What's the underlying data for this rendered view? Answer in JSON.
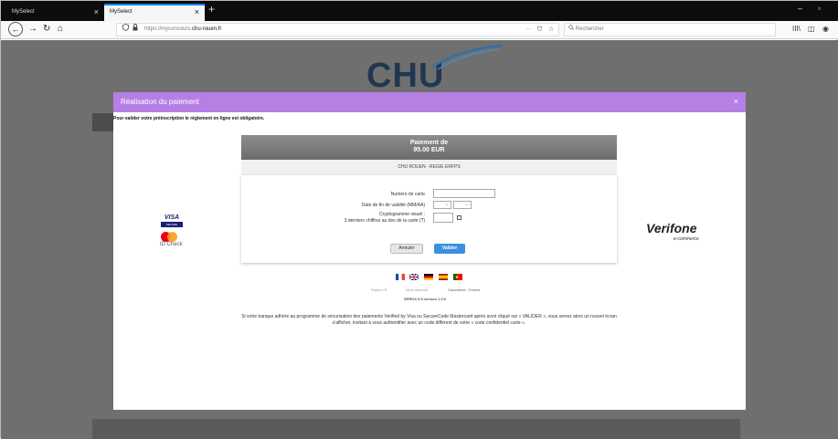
{
  "browser": {
    "tabs": [
      {
        "label": "MySelect"
      },
      {
        "label": "MySelect"
      }
    ],
    "new_tab": "+",
    "tab_close": "×",
    "window_controls": {
      "minimize": "–",
      "maximize": "▫"
    },
    "nav": {
      "back": "←",
      "forward": "→",
      "reload": "↻",
      "home": "⌂"
    },
    "url": {
      "prefix": "https://myconcours.",
      "domain": "chu-rouen.fr"
    },
    "url_actions": {
      "more": "···",
      "pocket": "⛉",
      "bookmark": "☆"
    },
    "search_placeholder": "Rechercher",
    "toolbar_icons": {
      "library": "III\\",
      "sidebar": "◫",
      "account": "◉"
    }
  },
  "page": {
    "logo": "CHU"
  },
  "modal": {
    "title": "Réalisation du paiement",
    "close": "×",
    "notice": "Pour valider votre préinscription le règlement en ligne est obligatoire.",
    "payment": {
      "heading": "Paiement de",
      "amount": "95.00 EUR",
      "merchant": "CHU ROUEN - REGIE ERFPS"
    },
    "form": {
      "card_number_label": "Numéro de carte",
      "expiry_label": "Date de fin de validité (MM/AA)",
      "cvv_label_line1": "Cryptogramme visuel :",
      "cvv_label_line2": "3 derniers chiffres au dos de la carte (?)",
      "select_arrow": "⌄",
      "cancel_label": "Annuler",
      "validate_label": "Valider"
    },
    "brands": {
      "visa": "VISA",
      "visa_secure": "SECURE",
      "idcheck": "ID Check",
      "verifone": "Verifone",
      "ecommerce": "e-commerce"
    },
    "footer_links": {
      "paybox": "Paybox ®",
      "infos": "Infos Absents",
      "commerce": "Commerce : France"
    },
    "version": "SPROX 5.5 version 1.0.0",
    "footnote": "Si votre banque adhère au programme de sécurisation des paiements Verified by Visa ou SecureCode Mastercard après avoir cliqué sur « VALIDER », vous verrez alors un nouvel écran s'afficher, invitant à vous authentifier avec un code différent de votre « code confidentiel carte »."
  }
}
